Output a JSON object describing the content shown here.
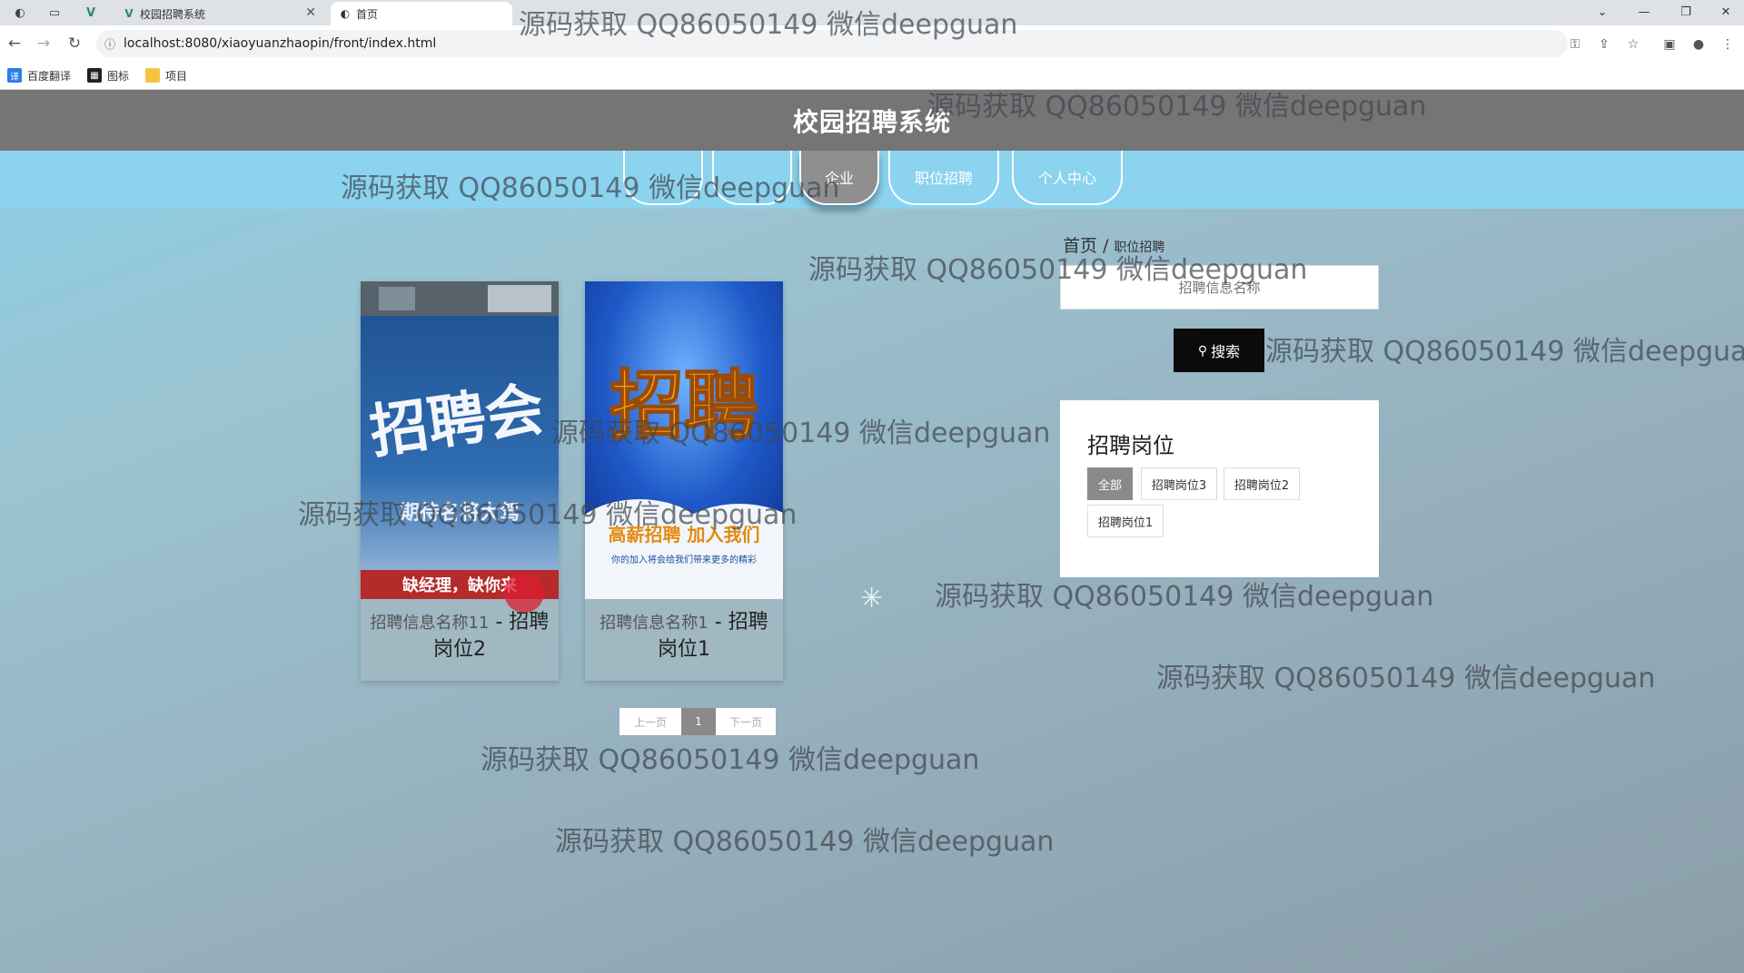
{
  "browser": {
    "tabs": [
      {
        "title": "校园招聘系统",
        "active": false
      },
      {
        "title": "首页",
        "active": true
      }
    ],
    "url": "localhost:8080/xiaoyuanzhaopin/front/index.html",
    "bookmarks": [
      {
        "label": "百度翻译",
        "icon": "translate-icon"
      },
      {
        "label": "图标",
        "icon": "image-icon"
      },
      {
        "label": "项目",
        "icon": "folder-icon"
      }
    ]
  },
  "site": {
    "title": "校园招聘系统",
    "nav": [
      {
        "label": "",
        "active": false
      },
      {
        "label": "",
        "active": false
      },
      {
        "label": "企业",
        "active": true
      },
      {
        "label": "职位招聘",
        "active": false
      },
      {
        "label": "个人中心",
        "active": false
      }
    ]
  },
  "breadcrumb": {
    "home": "首页",
    "separator": "/",
    "current": "职位招聘"
  },
  "search": {
    "placeholder": "招聘信息名称",
    "button_label": "搜索"
  },
  "filter": {
    "title": "招聘岗位",
    "options": [
      {
        "label": "全部",
        "active": true
      },
      {
        "label": "招聘岗位3",
        "active": false
      },
      {
        "label": "招聘岗位2",
        "active": false
      },
      {
        "label": "招聘岗位1",
        "active": false
      }
    ]
  },
  "cards": [
    {
      "name": "招聘信息名称11",
      "dash": " - ",
      "position": "招聘岗位2",
      "poster": {
        "big_text": "招聘会",
        "sub_text": "期待名将大驾",
        "bottom_text": "缺经理，缺你来",
        "bg": "#2a5b9a"
      }
    },
    {
      "name": "招聘信息名称1",
      "dash": " - ",
      "position": "招聘岗位1",
      "poster": {
        "big_text": "招聘",
        "sub_text": "高薪招聘 加入我们",
        "small_text": "你的加入将会给我们带来更多的精彩",
        "bg": "#1f59c8"
      }
    }
  ],
  "pager": {
    "prev": "上一页",
    "current": "1",
    "next": "下一页"
  },
  "watermark_text": "源码获取 QQ86050149 微信deepguan"
}
